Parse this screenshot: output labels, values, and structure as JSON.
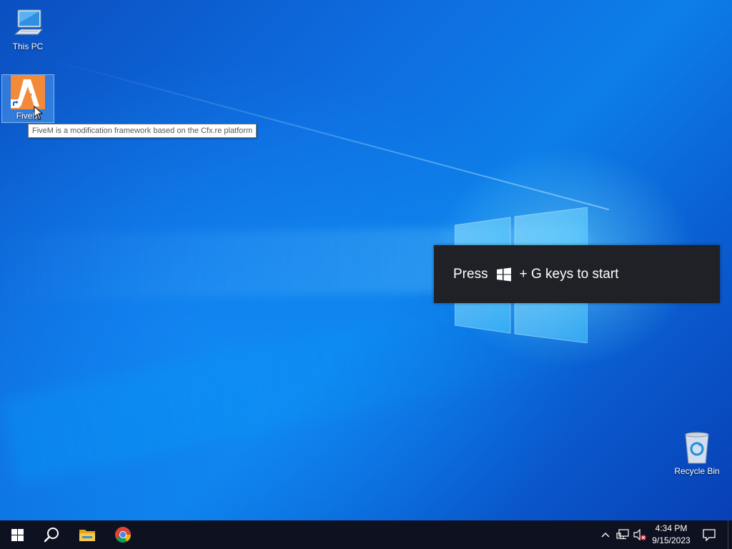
{
  "desktop": {
    "icons": [
      {
        "label": "This PC",
        "icon": "computer-icon"
      },
      {
        "label": "FiveM",
        "icon": "fivem-icon"
      },
      {
        "label": "Recycle Bin",
        "icon": "recycle-bin-icon"
      }
    ],
    "tooltip": "FiveM is a modification framework based on the Cfx.re platform"
  },
  "toast": {
    "text_before": "Press",
    "text_after": "+ G keys to start",
    "key_icon": "windows-key-icon"
  },
  "taskbar": {
    "pinned": [
      {
        "name": "start",
        "icon": "windows-start-icon"
      },
      {
        "name": "search",
        "icon": "search-icon"
      },
      {
        "name": "file-explorer",
        "icon": "folder-icon"
      },
      {
        "name": "chrome",
        "icon": "chrome-icon"
      }
    ],
    "tray": {
      "chevron_icon": "chevron-up-icon",
      "network_icon": "network-icon",
      "volume_icon": "volume-muted-icon"
    },
    "clock": {
      "time": "4:34 PM",
      "date": "9/15/2023"
    },
    "notification_icon": "action-center-icon"
  },
  "colors": {
    "taskbar": "#0e1220",
    "toast_bg": "#1f2127",
    "fivem_orange": "#f28a3a",
    "desktop_blue": "#0a58c8"
  }
}
